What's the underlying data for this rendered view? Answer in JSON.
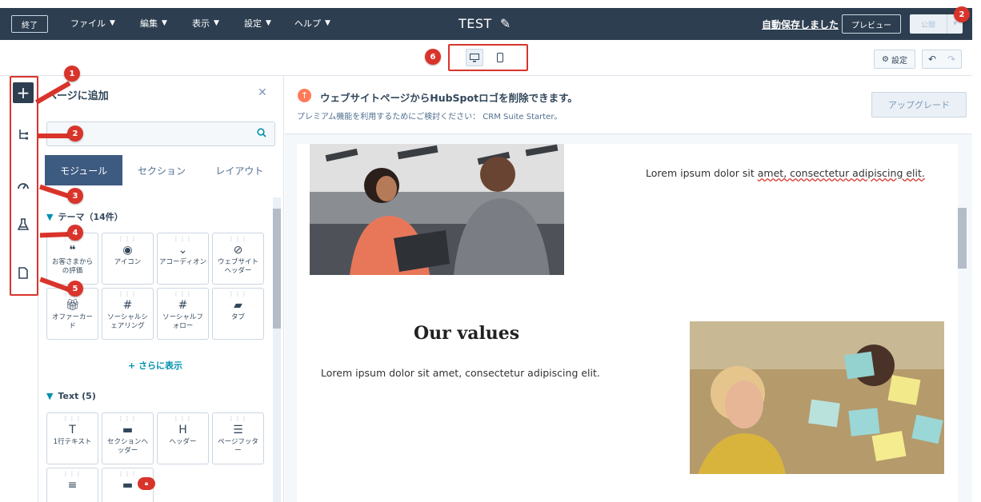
{
  "topbar": {
    "exit_label": "終了",
    "menus": [
      {
        "label": "ファイル"
      },
      {
        "label": "編集"
      },
      {
        "label": "表示"
      },
      {
        "label": "設定"
      },
      {
        "label": "ヘルプ"
      }
    ],
    "page_title": "TEST",
    "autosave_text": "自動保存しました",
    "preview_label": "プレビュー",
    "publish_label": "公開"
  },
  "toolbar": {
    "settings_label": "設定"
  },
  "panel": {
    "title": "ページに追加",
    "search_placeholder": "",
    "tabs": [
      {
        "label": "モジュール"
      },
      {
        "label": "セクション"
      },
      {
        "label": "レイアウト"
      }
    ],
    "theme_section": {
      "title": "テーマ（14件）",
      "items": [
        {
          "label": "お客さまからの評価",
          "icon": "quote-icon"
        },
        {
          "label": "アイコン",
          "icon": "target-icon"
        },
        {
          "label": "アコーディオン",
          "icon": "chevron-down-icon"
        },
        {
          "label": "ウェブサイトヘッダー",
          "icon": "compass-icon"
        },
        {
          "label": "オファーカード",
          "icon": "gift-icon"
        },
        {
          "label": "ソーシャルシェアリング",
          "icon": "hashtag-icon"
        },
        {
          "label": "ソーシャルフォロー",
          "icon": "hashtag-icon"
        },
        {
          "label": "タブ",
          "icon": "folder-icon"
        }
      ],
      "show_more": "+ さらに表示"
    },
    "text_section": {
      "title": "Text (5)",
      "items": [
        {
          "label": "1行テキスト",
          "icon": "text-icon"
        },
        {
          "label": "セクションヘッダー",
          "icon": "section-header-icon"
        },
        {
          "label": "ヘッダー",
          "icon": "heading-icon"
        },
        {
          "label": "ページフッター",
          "icon": "footer-icon"
        },
        {
          "label": "",
          "icon": "text-icon"
        },
        {
          "label": "",
          "icon": "text-icon"
        }
      ]
    }
  },
  "banner": {
    "title": "ウェブサイトページからHubSpotロゴを削除できます。",
    "subtitle": "プレミアム機能を利用するためにご検討ください： CRM Suite Starter。",
    "upgrade_label": "アップグレード"
  },
  "content": {
    "lorem_top_pre": "Lorem ipsum dolor sit ",
    "lorem_top_wavy": "amet, consectetur adipiscing elit.",
    "values_heading": "Our values",
    "lorem_values": "Lorem ipsum dolor sit amet, consectetur adipiscing elit."
  },
  "callouts": [
    "1",
    "2",
    "3",
    "4",
    "5",
    "6"
  ],
  "publish_badge": "2",
  "colors": {
    "topbar": "#2d3e50",
    "accent": "#0091ae",
    "callout": "#d9342b",
    "orange": "#ff7a59"
  }
}
